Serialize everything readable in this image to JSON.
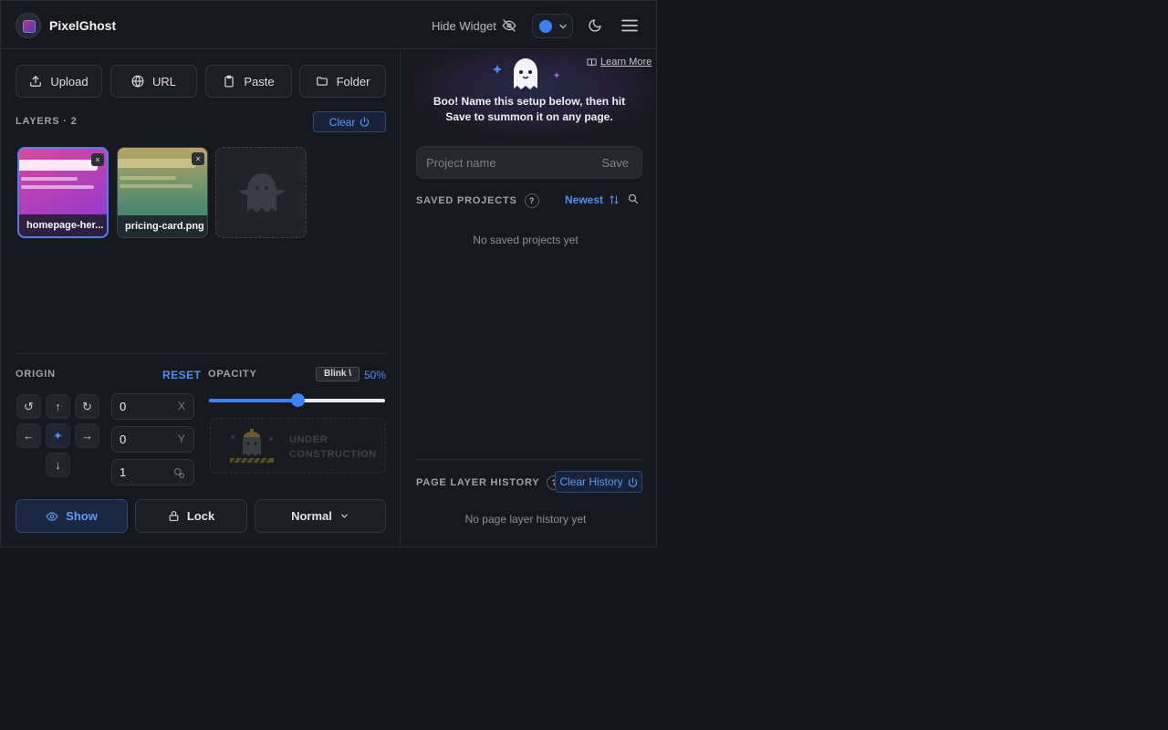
{
  "header": {
    "app_title": "PixelGhost",
    "hide_widget_label": "Hide Widget",
    "accent_color": "#3b82f6"
  },
  "sources": {
    "upload": "Upload",
    "url": "URL",
    "paste": "Paste",
    "folder": "Folder"
  },
  "layers": {
    "label": "LAYERS · 2",
    "clear_label": "Clear",
    "items": [
      {
        "name": "homepage-her...",
        "selected": true
      },
      {
        "name": "pricing-card.png",
        "selected": false
      }
    ],
    "close_glyph": "×"
  },
  "origin": {
    "label": "ORIGIN",
    "reset_label": "RESET",
    "x_value": "0",
    "x_unit": "X",
    "y_value": "0",
    "y_unit": "Y",
    "scale_value": "1"
  },
  "opacity": {
    "label": "OPACITY",
    "blink_label": "Blink \\",
    "value_text": "50%",
    "value_percent": 50,
    "construction_line1": "UNDER",
    "construction_line2": "CONSTRUCTION"
  },
  "footer": {
    "show_label": "Show",
    "lock_label": "Lock",
    "blend_mode": "Normal"
  },
  "right": {
    "learn_more": "Learn More",
    "boo_line1": "Boo! Name this setup below, then hit",
    "boo_line2": "Save to summon it on any page.",
    "project_placeholder": "Project name",
    "save_label": "Save",
    "saved_projects_label": "SAVED PROJECTS",
    "help_glyph": "?",
    "sort_label": "Newest",
    "no_projects": "No saved projects yet",
    "history_label": "PAGE LAYER HISTORY",
    "clear_history_label": "Clear History",
    "no_history": "No page layer history yet"
  }
}
